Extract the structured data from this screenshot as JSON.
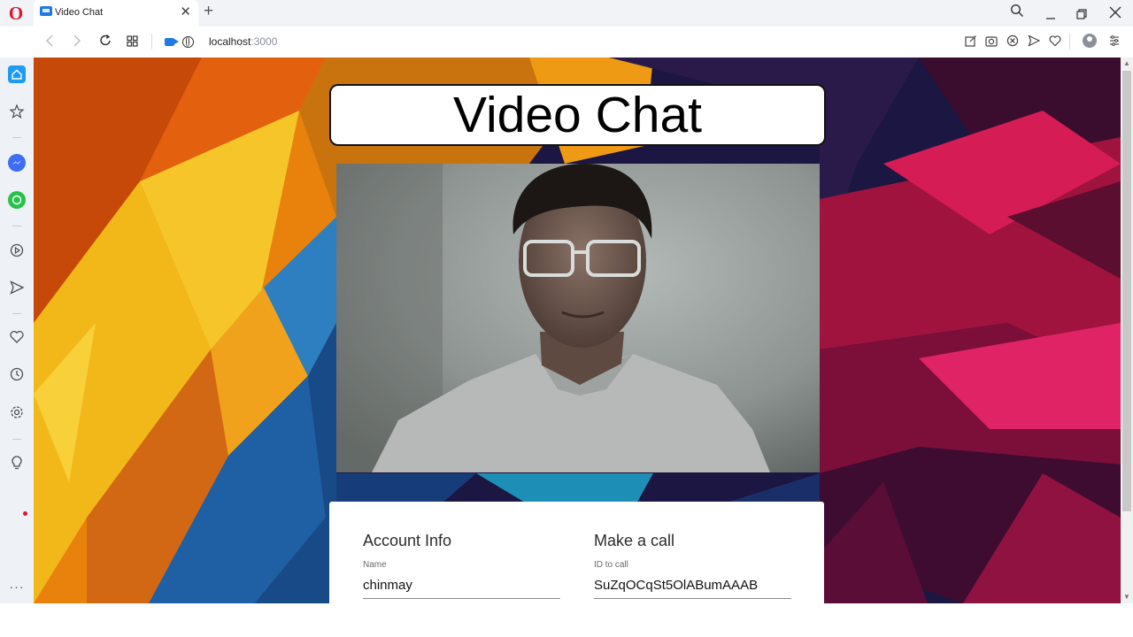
{
  "browser": {
    "tab_title": "Video Chat",
    "tab_close": "✕",
    "new_tab": "+",
    "url_host": "localhost",
    "url_port": ":3000"
  },
  "page": {
    "title": "Video Chat",
    "account": {
      "heading": "Account Info",
      "name_label": "Name",
      "name_value": "chinmay"
    },
    "call": {
      "heading": "Make a call",
      "id_label": "ID to call",
      "id_value": "SuZqOCqSt5OlABumAAAB"
    }
  },
  "colors": {
    "accent": "#1e9bf0",
    "opera_red": "#e0142b",
    "card_bg": "#ffffff"
  }
}
